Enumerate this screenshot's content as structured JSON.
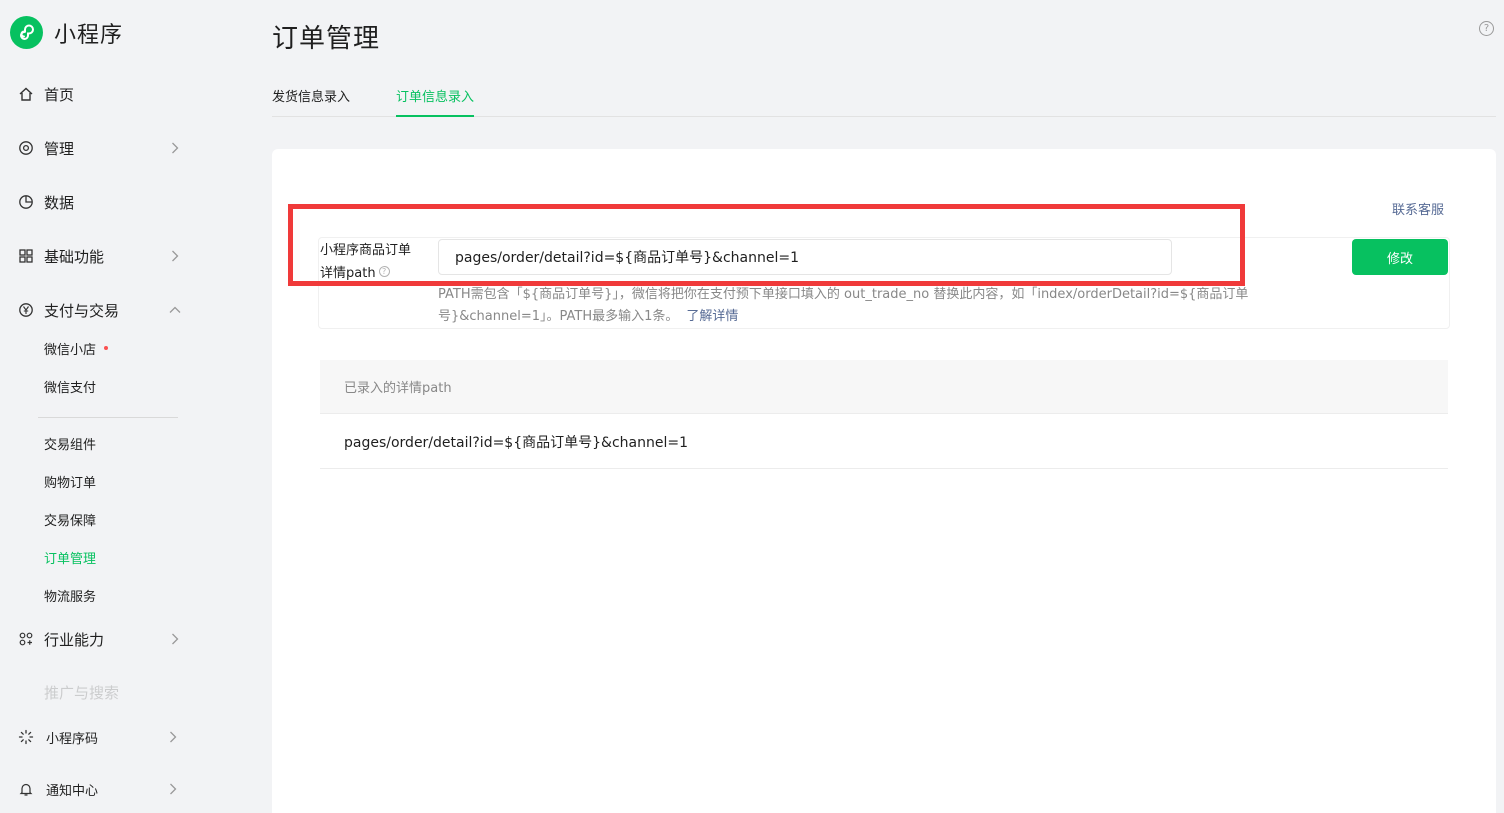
{
  "brand": {
    "name": "小程序"
  },
  "sidebar": {
    "items": [
      {
        "label": "首页"
      },
      {
        "label": "管理"
      },
      {
        "label": "数据"
      },
      {
        "label": "基础功能"
      },
      {
        "label": "支付与交易"
      },
      {
        "label": "行业能力"
      },
      {
        "label": "推广与搜索"
      },
      {
        "label": "小程序码"
      },
      {
        "label": "通知中心"
      }
    ],
    "sub_items": [
      {
        "label": "微信小店"
      },
      {
        "label": "微信支付"
      },
      {
        "label": "交易组件"
      },
      {
        "label": "购物订单"
      },
      {
        "label": "交易保障"
      },
      {
        "label": "订单管理"
      },
      {
        "label": "物流服务"
      }
    ]
  },
  "page": {
    "title": "订单管理",
    "help": "?"
  },
  "tabs": [
    {
      "label": "发货信息录入"
    },
    {
      "label": "订单信息录入"
    }
  ],
  "form": {
    "contact_label": "联系客服",
    "field_label_line1": "小程序商品订单",
    "field_label_line2": "详情path",
    "input_value": "pages/order/detail?id=${商品订单号}&channel=1",
    "submit_label": "修改",
    "hint_line1": "PATH需包含「${商品订单号}」，微信将把你在支付预下单接口填入的 out_trade_no 替换此内容，如「index/orderDetail?id=${商品订单",
    "hint_line2": "号}&channel=1」。PATH最多输入1条。",
    "learn_more": "了解详情"
  },
  "table": {
    "header": "已录入的详情path",
    "rows": [
      {
        "path": "pages/order/detail?id=${商品订单号}&channel=1"
      }
    ]
  },
  "colors": {
    "accent": "#07c160",
    "link": "#576b95",
    "highlight": "#f03a3a"
  }
}
